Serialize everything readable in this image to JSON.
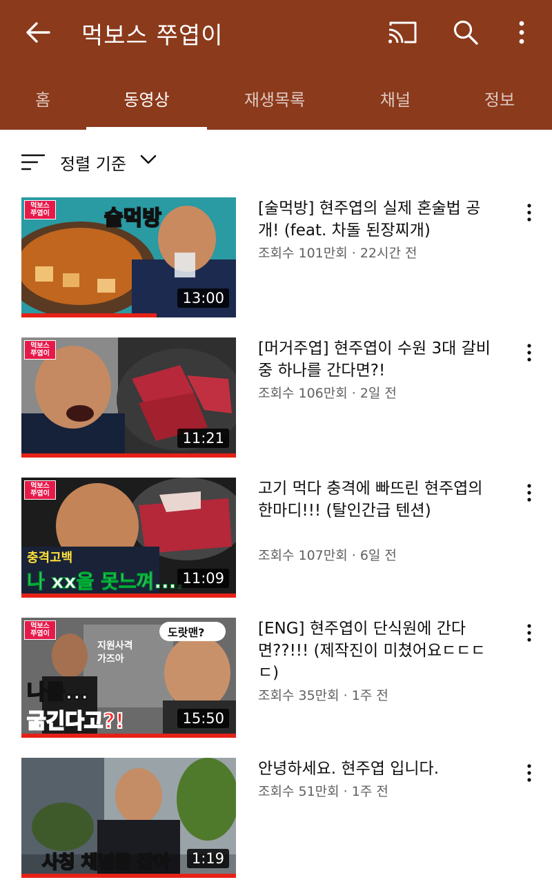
{
  "channel": {
    "title": "먹보스 쭈엽이"
  },
  "header_icons": {
    "back": "arrow-back-icon",
    "cast": "cast-icon",
    "search": "search-icon",
    "more": "more-vert-icon"
  },
  "tabs": [
    {
      "label": "홈",
      "active": false
    },
    {
      "label": "동영상",
      "active": true
    },
    {
      "label": "재생목록",
      "active": false
    },
    {
      "label": "채널",
      "active": false
    },
    {
      "label": "정보",
      "active": false
    }
  ],
  "sort": {
    "label": "정렬 기준"
  },
  "colors": {
    "appbar": "#8b3a1c",
    "progress": "#e62117",
    "meta": "#606060"
  },
  "videos": [
    {
      "title": "[술먹방] 현주엽의 실제 혼술법 공개! (feat. 차돌 된장찌개)",
      "meta": "조회수 101만회 · 22시간 전",
      "duration": "13:00",
      "thumb_badge": "먹보스 쭈엽이",
      "thumb_text": "술먹방",
      "watched": 0.63
    },
    {
      "title": "[머거주엽] 현주엽이 수원 3대 갈비 중 하나를 간다면?!",
      "meta": "조회수 106만회 · 2일 전",
      "duration": "11:21",
      "thumb_badge": "먹보스 쭈엽이",
      "thumb_text": "",
      "watched": 1.0
    },
    {
      "title": "고기 먹다 충격에 빠뜨린 현주엽의 한마디!!! (탈인간급 텐션)",
      "meta": "조회수 107만회 · 6일 전",
      "duration": "11:09",
      "thumb_badge": "먹보스 쭈엽이",
      "thumb_text": "충격고백",
      "thumb_text2": "나 xx을 못느껴....",
      "watched": 1.0
    },
    {
      "title": "[ENG] 현주엽이 단식원에 간다면??!!! (제작진이 미쳤어요ㄷㄷㄷㄷ)",
      "meta": "조회수 35만회 · 1주 전",
      "duration": "15:50",
      "thumb_badge": "먹보스 쭈엽이",
      "thumb_text": "나를...",
      "thumb_text2": "굶긴다고?!",
      "watched": 1.0
    },
    {
      "title": "안녕하세요. 현주엽 입니다.",
      "meta": "조회수 51만회 · 1주 전",
      "duration": "1:19",
      "thumb_badge": "",
      "thumb_text": "사칭 채널들 잡아",
      "watched": 1.0
    }
  ]
}
